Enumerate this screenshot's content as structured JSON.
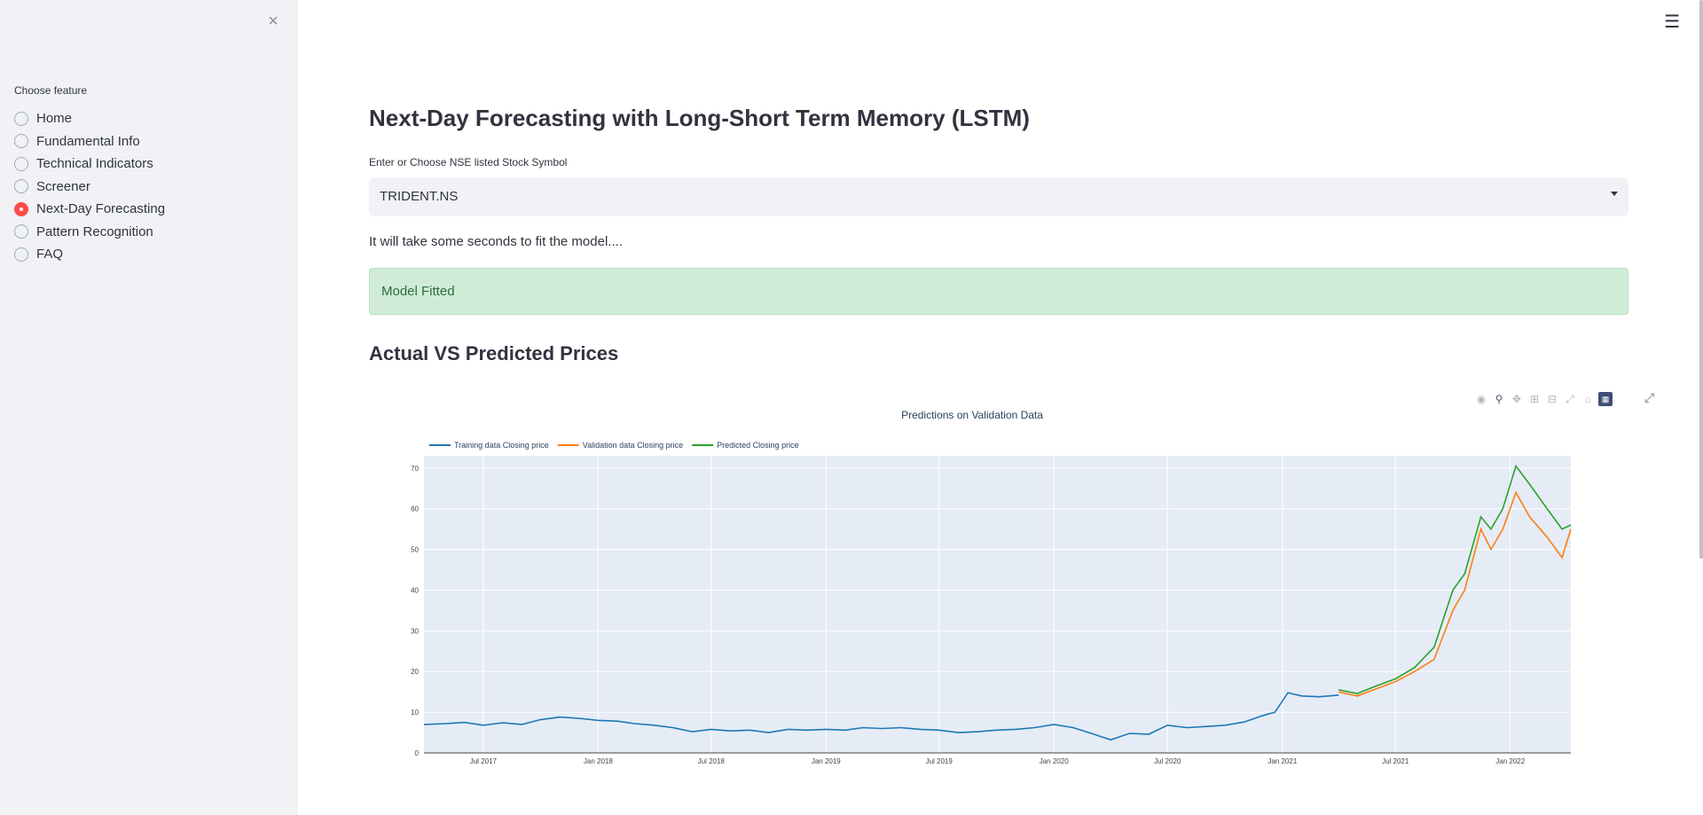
{
  "sidebar": {
    "close_icon": "×",
    "label": "Choose feature",
    "items": [
      {
        "label": "Home",
        "selected": false
      },
      {
        "label": "Fundamental Info",
        "selected": false
      },
      {
        "label": "Technical Indicators",
        "selected": false
      },
      {
        "label": "Screener",
        "selected": false
      },
      {
        "label": "Next-Day Forecasting",
        "selected": true
      },
      {
        "label": "Pattern Recognition",
        "selected": false
      },
      {
        "label": "FAQ",
        "selected": false
      }
    ]
  },
  "header": {
    "menu_icon": "☰"
  },
  "main": {
    "title": "Next-Day Forecasting with Long-Short Term Memory (LSTM)",
    "select_label": "Enter or Choose NSE listed Stock Symbol",
    "select_value": "TRIDENT.NS",
    "info": "It will take some seconds to fit the model....",
    "success": "Model Fitted",
    "section_title": "Actual VS Predicted Prices"
  },
  "icons": {
    "modebar": [
      "camera-icon",
      "zoom-icon",
      "pan-icon",
      "zoom-in-icon",
      "zoom-out-icon",
      "autoscale-icon",
      "reset-axes-icon",
      "plotly-logo-icon"
    ],
    "fullscreen": "fullscreen-icon"
  },
  "colors": {
    "accent": "#ff4b4b",
    "training": "#1f77b4",
    "validation": "#ff7f0e",
    "predicted": "#2ca02c",
    "plot_bg": "#e5ecf6"
  },
  "chart_data": {
    "type": "line",
    "title": "Predictions on Validation Data",
    "xlabel": "",
    "ylabel": "",
    "ylim": [
      0,
      73
    ],
    "xlim": [
      "2017-03-28",
      "2022-04-08"
    ],
    "x_ticks": [
      "Jul 2017",
      "Jan 2018",
      "Jul 2018",
      "Jan 2019",
      "Jul 2019",
      "Jan 2020",
      "Jul 2020",
      "Jan 2021",
      "Jul 2021",
      "Jan 2022"
    ],
    "y_ticks": [
      0,
      10,
      20,
      30,
      40,
      50,
      60,
      70
    ],
    "legend": "top-left",
    "grid": true,
    "series": [
      {
        "name": "Training data Closing price",
        "points": [
          [
            "2017-03-28",
            7.0
          ],
          [
            "2017-05-01",
            7.2
          ],
          [
            "2017-06-01",
            7.5
          ],
          [
            "2017-07-01",
            6.8
          ],
          [
            "2017-08-01",
            7.4
          ],
          [
            "2017-09-01",
            7.0
          ],
          [
            "2017-10-01",
            8.2
          ],
          [
            "2017-11-01",
            8.8
          ],
          [
            "2017-12-01",
            8.5
          ],
          [
            "2018-01-01",
            8.0
          ],
          [
            "2018-02-01",
            7.8
          ],
          [
            "2018-03-01",
            7.2
          ],
          [
            "2018-04-01",
            6.8
          ],
          [
            "2018-05-01",
            6.2
          ],
          [
            "2018-06-01",
            5.2
          ],
          [
            "2018-07-01",
            5.8
          ],
          [
            "2018-08-01",
            5.4
          ],
          [
            "2018-09-01",
            5.6
          ],
          [
            "2018-10-01",
            5.0
          ],
          [
            "2018-11-01",
            5.8
          ],
          [
            "2018-12-01",
            5.6
          ],
          [
            "2019-01-01",
            5.8
          ],
          [
            "2019-02-01",
            5.6
          ],
          [
            "2019-03-01",
            6.2
          ],
          [
            "2019-04-01",
            6.0
          ],
          [
            "2019-05-01",
            6.2
          ],
          [
            "2019-06-01",
            5.8
          ],
          [
            "2019-07-01",
            5.6
          ],
          [
            "2019-08-01",
            5.0
          ],
          [
            "2019-09-01",
            5.2
          ],
          [
            "2019-10-01",
            5.6
          ],
          [
            "2019-11-01",
            5.8
          ],
          [
            "2019-12-01",
            6.2
          ],
          [
            "2020-01-01",
            7.0
          ],
          [
            "2020-02-01",
            6.2
          ],
          [
            "2020-03-01",
            4.8
          ],
          [
            "2020-04-01",
            3.2
          ],
          [
            "2020-05-01",
            4.8
          ],
          [
            "2020-06-01",
            4.6
          ],
          [
            "2020-07-01",
            6.8
          ],
          [
            "2020-08-01",
            6.2
          ],
          [
            "2020-09-01",
            6.5
          ],
          [
            "2020-10-01",
            6.8
          ],
          [
            "2020-11-01",
            7.6
          ],
          [
            "2020-12-01",
            9.2
          ],
          [
            "2020-12-20",
            10.0
          ],
          [
            "2021-01-10",
            14.8
          ],
          [
            "2021-02-01",
            14.0
          ],
          [
            "2021-03-01",
            13.8
          ],
          [
            "2021-04-01",
            14.2
          ]
        ]
      },
      {
        "name": "Validation data Closing price",
        "points": [
          [
            "2021-04-01",
            15.0
          ],
          [
            "2021-05-01",
            14.0
          ],
          [
            "2021-06-01",
            15.8
          ],
          [
            "2021-07-01",
            17.5
          ],
          [
            "2021-08-01",
            20.0
          ],
          [
            "2021-09-01",
            23.0
          ],
          [
            "2021-10-01",
            35.0
          ],
          [
            "2021-10-20",
            40.0
          ],
          [
            "2021-11-15",
            55.0
          ],
          [
            "2021-12-01",
            50.0
          ],
          [
            "2021-12-20",
            55.0
          ],
          [
            "2022-01-10",
            64.0
          ],
          [
            "2022-02-01",
            58.0
          ],
          [
            "2022-03-01",
            53.0
          ],
          [
            "2022-03-25",
            48.0
          ],
          [
            "2022-04-08",
            55.0
          ]
        ]
      },
      {
        "name": "Predicted Closing price",
        "points": [
          [
            "2021-04-01",
            15.5
          ],
          [
            "2021-05-01",
            14.6
          ],
          [
            "2021-06-01",
            16.5
          ],
          [
            "2021-07-01",
            18.2
          ],
          [
            "2021-08-01",
            21.0
          ],
          [
            "2021-09-01",
            26.0
          ],
          [
            "2021-10-01",
            40.0
          ],
          [
            "2021-10-20",
            44.0
          ],
          [
            "2021-11-15",
            58.0
          ],
          [
            "2021-12-01",
            55.0
          ],
          [
            "2021-12-20",
            60.0
          ],
          [
            "2022-01-10",
            70.5
          ],
          [
            "2022-02-01",
            66.0
          ],
          [
            "2022-03-01",
            60.0
          ],
          [
            "2022-03-25",
            55.0
          ],
          [
            "2022-04-08",
            56.0
          ]
        ]
      }
    ]
  }
}
